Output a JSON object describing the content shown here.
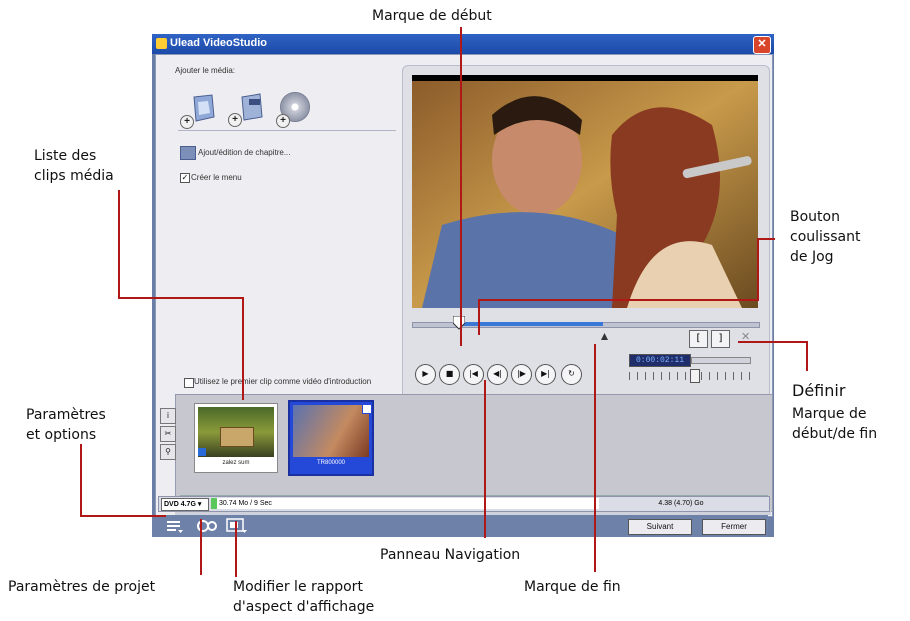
{
  "window": {
    "title": "Ulead VideoStudio",
    "close_label": "✕"
  },
  "media": {
    "add_label": "Ajouter le média:",
    "buttons": [
      {
        "icon": "video-file-icon"
      },
      {
        "icon": "vob-file-icon"
      },
      {
        "icon": "disc-icon"
      }
    ]
  },
  "chapter": {
    "label": "Ajout/édition de chapitre..."
  },
  "create_menu": {
    "label": "Créer le menu",
    "checked": true
  },
  "intro": {
    "label": "Utilisez le premier clip comme vidéo d'introduction",
    "checked": false
  },
  "timecode": "0:00:02:11",
  "nav_buttons": [
    "play-icon",
    "stop-icon",
    "go-start-icon",
    "prev-frame-icon",
    "next-frame-icon",
    "go-end-icon",
    "repeat-icon"
  ],
  "mark_buttons": {
    "in": "[",
    "out": "]"
  },
  "clips": [
    {
      "name": "zalez sum",
      "selected": false
    },
    {
      "name": "TR800000",
      "selected": true
    }
  ],
  "status": {
    "disc_select": "DVD 4.7G",
    "size_info": "30.74 Mo / 9 Sec",
    "capacity": "4.38 (4.70) Go"
  },
  "buttons": {
    "next": "Suivant",
    "close": "Fermer"
  },
  "callouts": {
    "marque_debut": "Marque de début",
    "liste_clips_1": "Liste des",
    "liste_clips_2": "clips média",
    "jog_1": "Bouton",
    "jog_2": "coulissant",
    "jog_3": "de Jog",
    "definir": "Définir",
    "definir_sub_1": "Marque de",
    "definir_sub_2": "début/de fin",
    "parametres_1": "Paramètres",
    "parametres_2": "et options",
    "panneau": "Panneau Navigation",
    "marque_fin": "Marque de fin",
    "params_projet": "Paramètres de projet",
    "rapport_1": "Modifier le rapport",
    "rapport_2": "d'aspect d'affichage"
  }
}
